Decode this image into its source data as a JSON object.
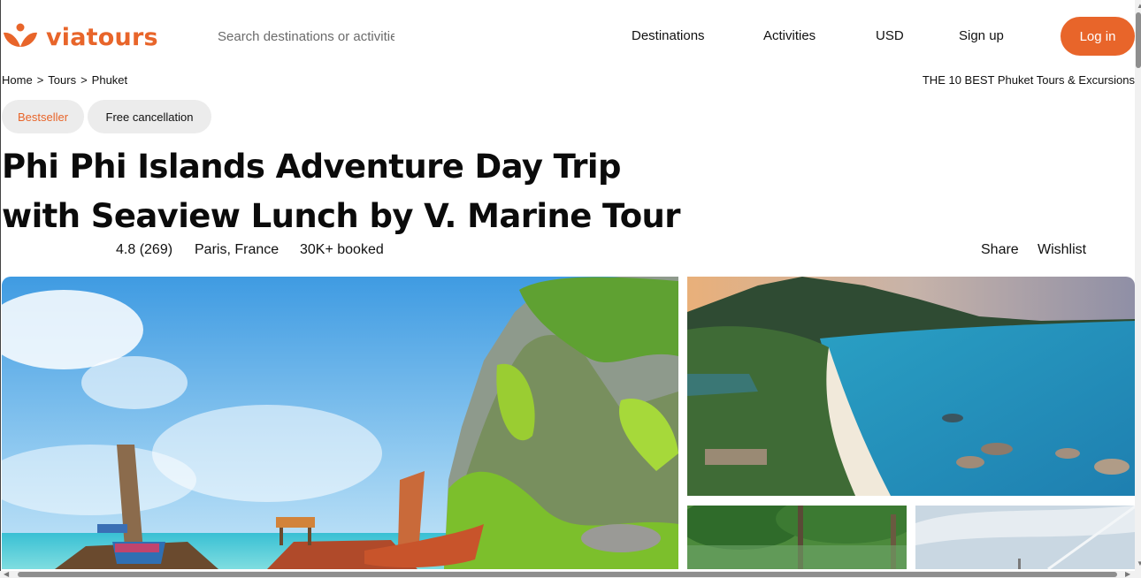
{
  "header": {
    "brand": "viatours",
    "search_placeholder": "Search destinations or activities",
    "nav": [
      "Destinations",
      "Activities",
      "USD",
      "Sign up"
    ],
    "login_label": "Log in"
  },
  "breadcrumb": {
    "items": [
      "Home",
      "Tours",
      "Phuket"
    ],
    "separator": ">"
  },
  "best_link": "THE 10 BEST Phuket Tours & Excursions",
  "badges": {
    "bestseller": "Bestseller",
    "free_cancellation": "Free cancellation"
  },
  "tour": {
    "title": "Phi Phi Islands Adventure Day Trip with Seaview Lunch by V. Marine Tour",
    "rating": "4.8 (269)",
    "location": "Paris, France",
    "booked": "30K+ booked"
  },
  "actions": {
    "share": "Share",
    "wishlist": "Wishlist"
  },
  "colors": {
    "accent": "#e8652a",
    "badge_bg": "#ececec"
  },
  "icons": {
    "logo": "viatours-logo-icon"
  }
}
